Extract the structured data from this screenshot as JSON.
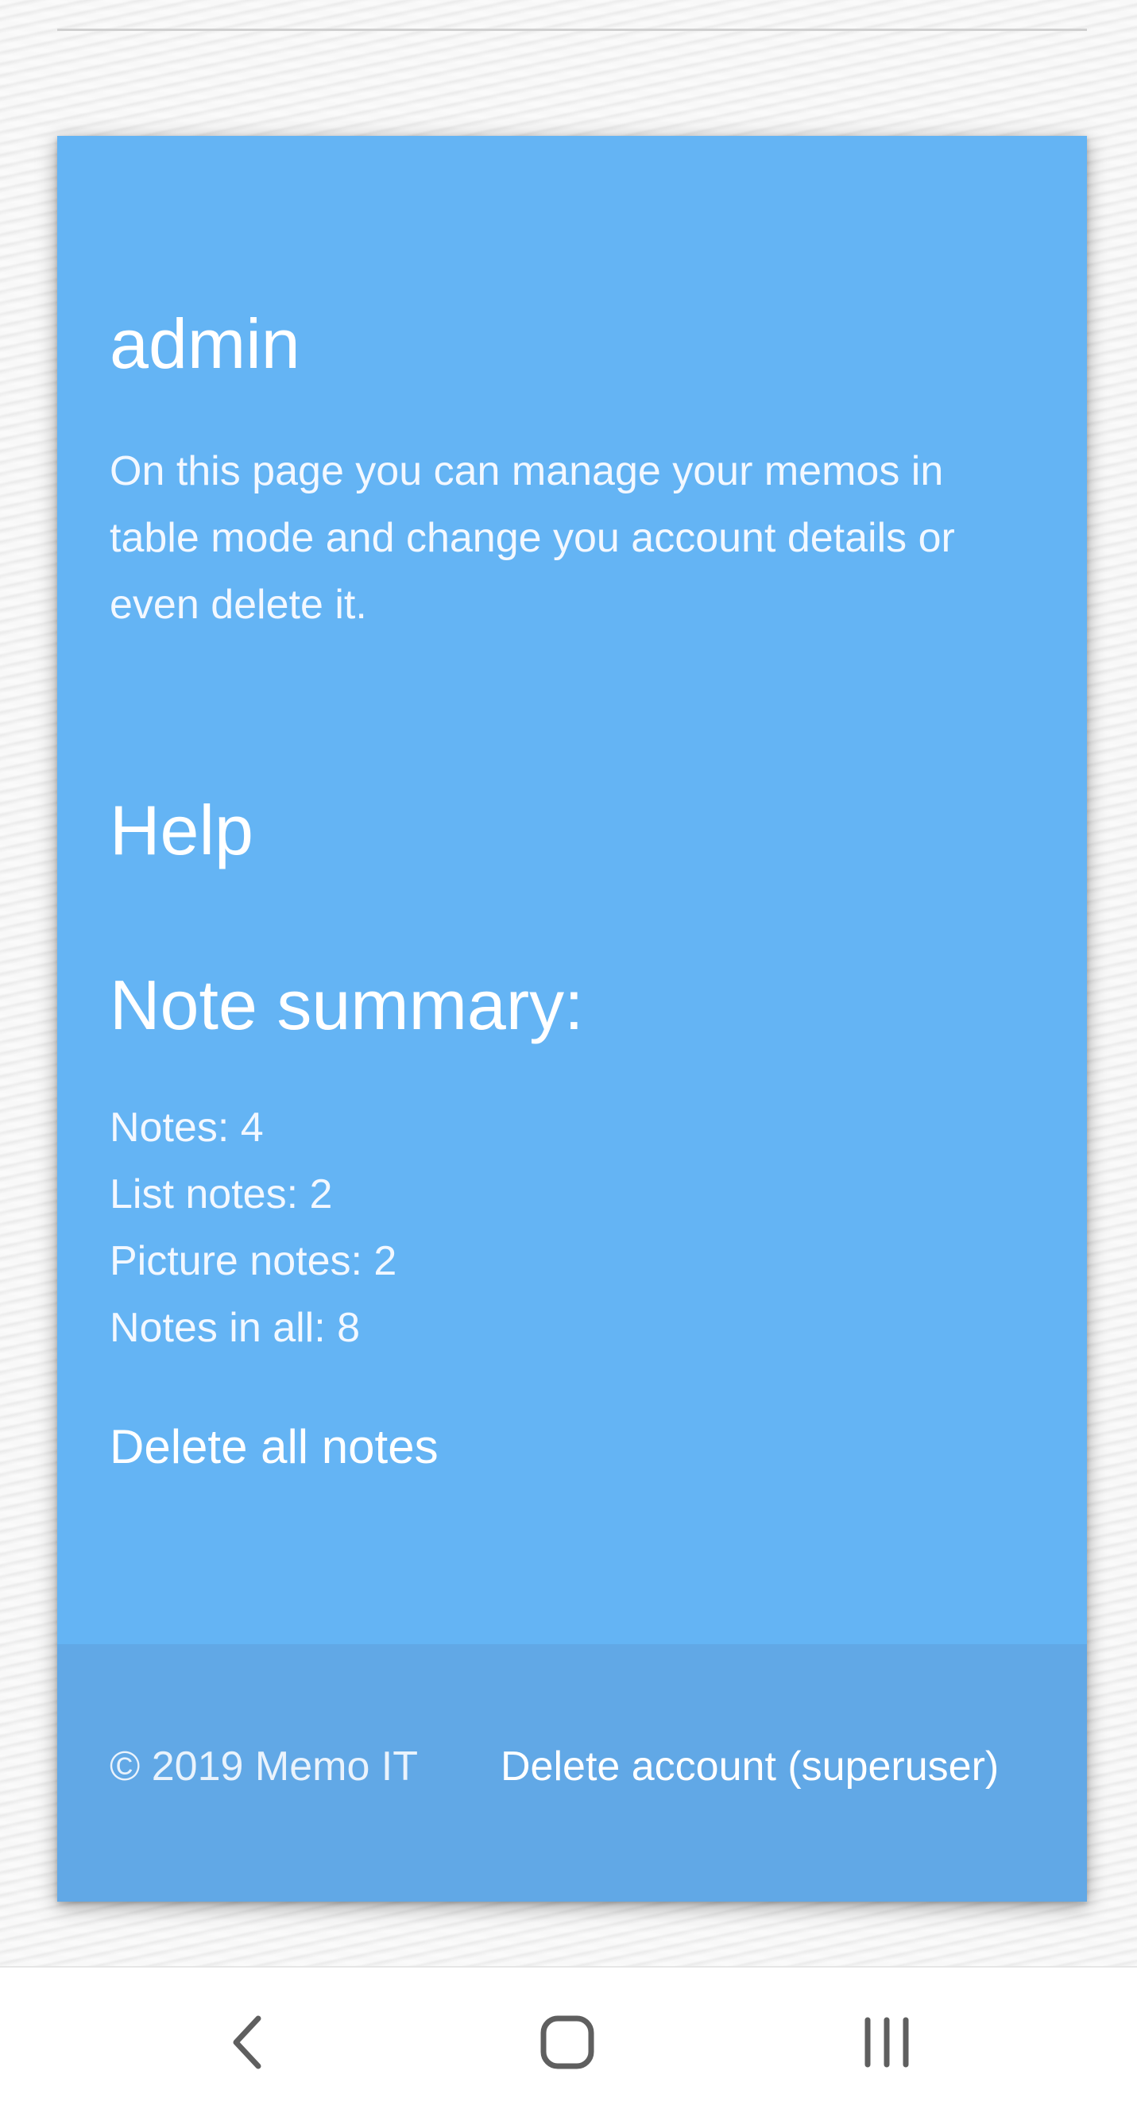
{
  "account": {
    "username": "admin",
    "description": "On this page you can manage your memos in table mode and change you account details or even delete it."
  },
  "help": {
    "label": "Help"
  },
  "summary": {
    "title": "Note summary:",
    "stats": [
      "Notes: 4",
      "List notes: 2",
      "Picture notes: 2",
      "Notes in all: 8"
    ],
    "delete_all_label": "Delete all notes"
  },
  "footer": {
    "copyright": "© 2019 Memo IT",
    "delete_account_label": "Delete account (superuser)"
  },
  "nav_bar": {
    "icons": [
      "back-icon",
      "home-icon",
      "recents-icon"
    ]
  },
  "colors": {
    "card": "#64b4f4",
    "footer": "#61a8e6",
    "text": "#ffffff"
  }
}
